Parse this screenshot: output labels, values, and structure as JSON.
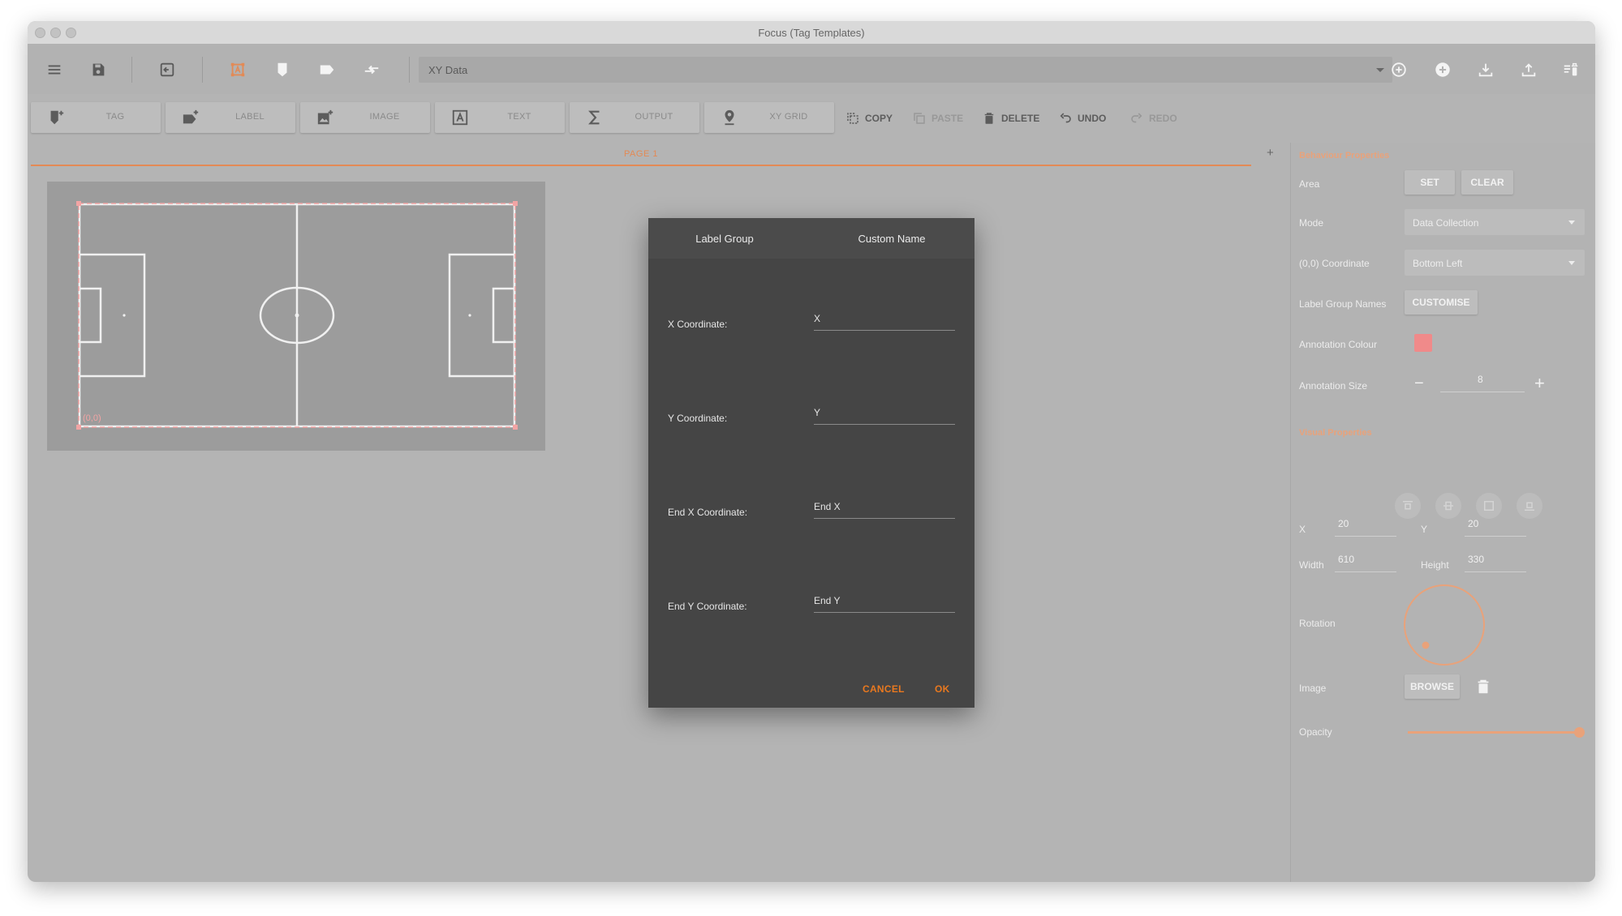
{
  "window": {
    "title": "Focus (Tag Templates)"
  },
  "toolbar": {
    "dropdown_value": "XY Data",
    "icons": [
      "menu-icon",
      "save-icon",
      "exit-icon",
      "select-area-icon",
      "tag-icon",
      "label-icon",
      "swap-icon",
      "add-circle-outline-icon",
      "add-circle-icon",
      "download-icon",
      "upload-icon",
      "delete-list-icon"
    ]
  },
  "tools": {
    "tag": "TAG",
    "label": "LABEL",
    "image": "IMAGE",
    "text": "TEXT",
    "output": "OUTPUT",
    "xy_grid": "XY GRID",
    "copy": "COPY",
    "paste": "PASTE",
    "delete": "DELETE",
    "undo": "UNDO",
    "redo": "REDO"
  },
  "pages": {
    "tab": "PAGE 1",
    "add": "+"
  },
  "canvas": {
    "origin_label": "(0,0)"
  },
  "dialog": {
    "tabs": [
      "Label Group",
      "Custom Name"
    ],
    "fields": [
      {
        "label": "X Coordinate:",
        "value": "X"
      },
      {
        "label": "Y Coordinate:",
        "value": "Y"
      },
      {
        "label": "End X Coordinate:",
        "value": "End X"
      },
      {
        "label": "End Y Coordinate:",
        "value": "End Y"
      }
    ],
    "cancel": "CANCEL",
    "ok": "OK"
  },
  "panel": {
    "behaviour_title": "Behaviour Properties",
    "area_label": "Area",
    "set": "SET",
    "clear": "CLEAR",
    "mode_label": "Mode",
    "mode_value": "Data Collection",
    "coord_label": "(0,0) Coordinate",
    "coord_value": "Bottom Left",
    "lgn_label": "Label Group Names",
    "customise": "CUSTOMISE",
    "colour_label": "Annotation Colour",
    "colour": "#f08a8a",
    "size_label": "Annotation Size",
    "size_value": "8",
    "minus": "−",
    "plus": "+",
    "visual_title": "Visual Properties",
    "x_label": "X",
    "x_value": "20",
    "y_label": "Y",
    "y_value": "20",
    "width_label": "Width",
    "width_value": "610",
    "height_label": "Height",
    "height_value": "330",
    "rotation_label": "Rotation",
    "image_label": "Image",
    "browse": "BROWSE",
    "opacity_label": "Opacity",
    "opacity": 1.0
  },
  "colors": {
    "accent": "#e38a55",
    "dialog_action": "#e8781f"
  }
}
